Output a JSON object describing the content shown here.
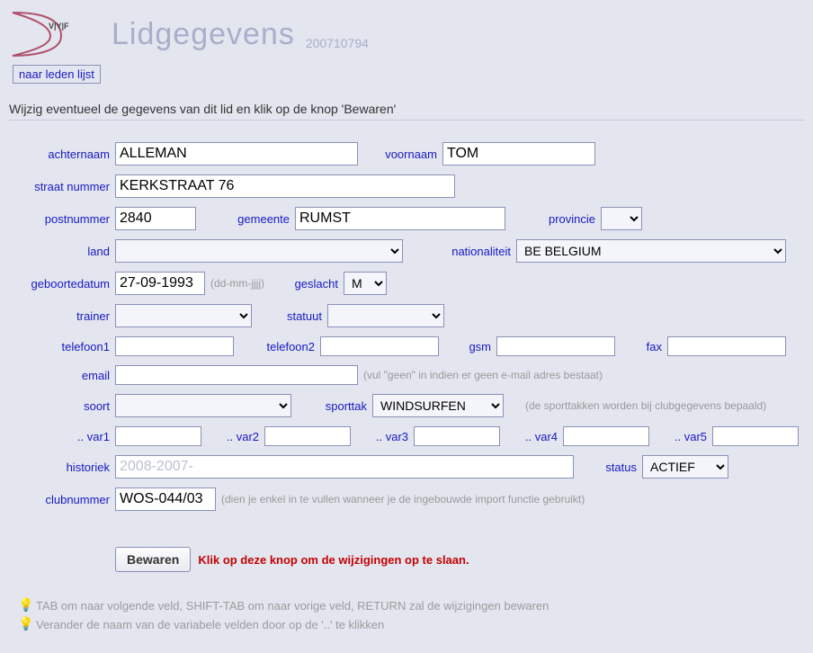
{
  "header": {
    "title": "Lidgegevens",
    "member_id": "200710794",
    "back_link": "naar leden lijst"
  },
  "instruction": "Wijzig eventueel de gegevens van dit lid en klik op de knop 'Bewaren'",
  "labels": {
    "achternaam": "achternaam",
    "voornaam": "voornaam",
    "straat": "straat nummer",
    "postnummer": "postnummer",
    "gemeente": "gemeente",
    "provincie": "provincie",
    "land": "land",
    "nationaliteit": "nationaliteit",
    "geboortedatum": "geboortedatum",
    "date_format": "(dd-mm-jjjj)",
    "geslacht": "geslacht",
    "trainer": "trainer",
    "statuut": "statuut",
    "telefoon1": "telefoon1",
    "telefoon2": "telefoon2",
    "gsm": "gsm",
    "fax": "fax",
    "email": "email",
    "email_hint": "(vul \"geen\" in indien er geen e-mail adres bestaat)",
    "soort": "soort",
    "sporttak": "sporttak",
    "sporttak_hint": "(de sporttakken worden bij clubgegevens bepaald)",
    "var1": ".. var1",
    "var2": ".. var2",
    "var3": ".. var3",
    "var4": ".. var4",
    "var5": ".. var5",
    "historiek": "historiek",
    "status": "status",
    "clubnummer": "clubnummer",
    "clubnummer_hint": "(dien je enkel in te vullen wanneer je de ingebouwde import functie gebruikt)"
  },
  "values": {
    "achternaam": "ALLEMAN",
    "voornaam": "TOM",
    "straat": "KERKSTRAAT 76",
    "postnummer": "2840",
    "gemeente": "RUMST",
    "provincie": "",
    "land": "",
    "nationaliteit": "BE BELGIUM",
    "geboortedatum": "27-09-1993",
    "geslacht": "M",
    "trainer": "",
    "statuut": "",
    "telefoon1": "",
    "telefoon2": "",
    "gsm": "",
    "fax": "",
    "email": "",
    "soort": "",
    "sporttak": "WINDSURFEN",
    "var1": "",
    "var2": "",
    "var3": "",
    "var4": "",
    "var5": "",
    "historiek": "2008-2007-",
    "status": "ACTIEF",
    "clubnummer": "WOS-044/03"
  },
  "save": {
    "button": "Bewaren",
    "hint": "Klik op deze knop om de wijzigingen op te slaan."
  },
  "tips": {
    "t1": "TAB om naar volgende veld, SHIFT-TAB om naar vorige veld, RETURN zal de wijzigingen bewaren",
    "t2": "Verander de naam van de variabele velden door op de '..' te klikken"
  }
}
